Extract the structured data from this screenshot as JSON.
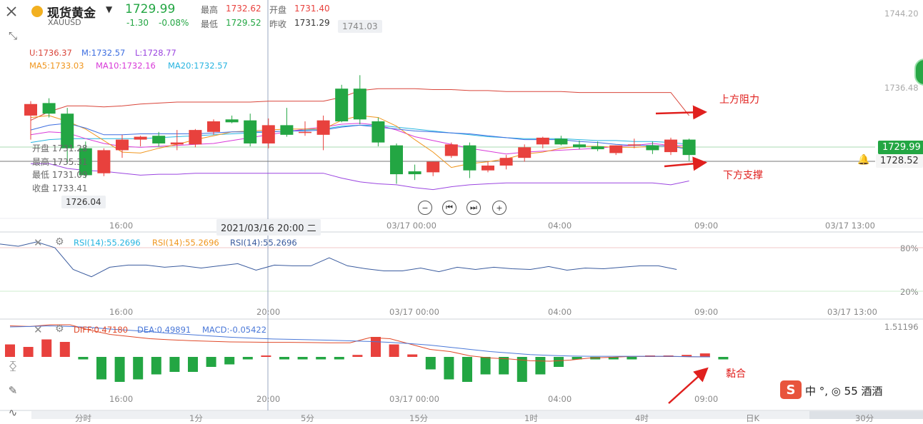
{
  "header": {
    "symbol_name": "现货黄金",
    "symbol_code": "XAUUSD",
    "price": "1729.99",
    "change": "-1.30",
    "change_pct": "-0.08%",
    "high_label": "最高",
    "high": "1732.62",
    "low_label": "最低",
    "low": "1729.52",
    "open_label": "开盘",
    "open": "1731.40",
    "prev_label": "昨收",
    "prev_close": "1731.29"
  },
  "indicators": {
    "boll_u": "U:1736.37",
    "boll_m": "M:1732.57",
    "boll_l": "L:1728.77",
    "ma5": "MA5:1733.03",
    "ma10": "MA10:1732.16",
    "ma20": "MA20:1732.57"
  },
  "crosshair": {
    "open_label": "开盘",
    "open": "1731.28",
    "high_label": "最高",
    "high": "1735.31",
    "low_label": "最低",
    "low": "1731.09",
    "close_label": "收盘",
    "close": "1733.41",
    "price_tag": "1726.04",
    "time_tag": "2021/03/16 20:00 二"
  },
  "price_axis": {
    "top": "1744.20",
    "mid": "1736.48",
    "current": "1729.99",
    "line": "1728.52"
  },
  "high_tag": "1741.03",
  "time_labels": [
    "16:00",
    "20:00",
    "03/17 00:00",
    "04:00",
    "09:00",
    "03/17 13:00"
  ],
  "rsi": {
    "label1": "RSI(14):55.2696",
    "label2": "RSI(14):55.2696",
    "label3": "RSI(14):55.2696",
    "axis_hi": "80%",
    "axis_lo": "20%"
  },
  "macd": {
    "diff": "DIFF:0.47180",
    "dea": "DEA:0.49891",
    "macd": "MACD:-0.05422",
    "axis": "1.51196"
  },
  "annotations": {
    "resistance": "上方阻力",
    "support": "下方支撑",
    "converge": "黏合"
  },
  "bottom_tabs": [
    "分时",
    "1分",
    "5分",
    "15分",
    "1时",
    "4时",
    "日K",
    "30分"
  ],
  "watermark_text": "中 °, ◎ 55 酒酒",
  "colors": {
    "up": "#e8413d",
    "down": "#23a643",
    "boll_u": "#d9453a",
    "boll_m": "#3d6ee0",
    "boll_l": "#9b45e0",
    "ma5": "#f0961e",
    "ma10": "#d83ad8",
    "ma20": "#27b4e0",
    "rsi": "#3a5b9e",
    "diff": "#e04a2a",
    "dea": "#4a78d8"
  },
  "chart_data": {
    "type": "candlestick",
    "candles": [
      {
        "o": 1734.0,
        "h": 1735.5,
        "l": 1731.5,
        "c": 1735.2
      },
      {
        "o": 1735.3,
        "h": 1735.8,
        "l": 1733.8,
        "c": 1734.2
      },
      {
        "o": 1734.2,
        "h": 1734.8,
        "l": 1729.0,
        "c": 1730.6
      },
      {
        "o": 1730.6,
        "h": 1731.3,
        "l": 1727.5,
        "c": 1727.8
      },
      {
        "o": 1728.0,
        "h": 1730.6,
        "l": 1727.7,
        "c": 1730.4
      },
      {
        "o": 1730.4,
        "h": 1732.0,
        "l": 1729.6,
        "c": 1731.5
      },
      {
        "o": 1731.5,
        "h": 1731.9,
        "l": 1730.8,
        "c": 1731.8
      },
      {
        "o": 1731.9,
        "h": 1732.3,
        "l": 1730.8,
        "c": 1731.1
      },
      {
        "o": 1731.0,
        "h": 1732.5,
        "l": 1730.4,
        "c": 1731.2
      },
      {
        "o": 1731.0,
        "h": 1732.6,
        "l": 1730.7,
        "c": 1732.5
      },
      {
        "o": 1732.3,
        "h": 1733.6,
        "l": 1732.0,
        "c": 1733.4
      },
      {
        "o": 1733.6,
        "h": 1734.0,
        "l": 1733.2,
        "c": 1733.3
      },
      {
        "o": 1733.5,
        "h": 1734.2,
        "l": 1730.8,
        "c": 1731.1
      },
      {
        "o": 1731.1,
        "h": 1733.7,
        "l": 1730.6,
        "c": 1733.0
      },
      {
        "o": 1733.0,
        "h": 1734.8,
        "l": 1731.8,
        "c": 1732.0
      },
      {
        "o": 1732.3,
        "h": 1733.4,
        "l": 1731.9,
        "c": 1732.3
      },
      {
        "o": 1732.0,
        "h": 1734.0,
        "l": 1730.4,
        "c": 1733.5
      },
      {
        "o": 1736.8,
        "h": 1737.2,
        "l": 1733.3,
        "c": 1733.4
      },
      {
        "o": 1736.8,
        "h": 1738.2,
        "l": 1733.1,
        "c": 1733.6
      },
      {
        "o": 1733.4,
        "h": 1733.8,
        "l": 1730.8,
        "c": 1731.2
      },
      {
        "o": 1730.9,
        "h": 1731.1,
        "l": 1726.9,
        "c": 1727.9
      },
      {
        "o": 1728.2,
        "h": 1728.9,
        "l": 1727.3,
        "c": 1727.9
      },
      {
        "o": 1728.1,
        "h": 1729.2,
        "l": 1727.7,
        "c": 1729.2
      },
      {
        "o": 1729.8,
        "h": 1731.2,
        "l": 1729.6,
        "c": 1731.0
      },
      {
        "o": 1730.9,
        "h": 1731.2,
        "l": 1727.5,
        "c": 1728.3
      },
      {
        "o": 1728.3,
        "h": 1729.2,
        "l": 1728.1,
        "c": 1728.8
      },
      {
        "o": 1728.8,
        "h": 1729.9,
        "l": 1728.4,
        "c": 1729.6
      },
      {
        "o": 1729.6,
        "h": 1731.0,
        "l": 1729.2,
        "c": 1730.7
      },
      {
        "o": 1731.0,
        "h": 1731.8,
        "l": 1730.6,
        "c": 1731.7
      },
      {
        "o": 1731.6,
        "h": 1731.9,
        "l": 1730.9,
        "c": 1731.0
      },
      {
        "o": 1731.0,
        "h": 1731.4,
        "l": 1730.5,
        "c": 1730.7
      },
      {
        "o": 1730.8,
        "h": 1731.3,
        "l": 1730.3,
        "c": 1730.5
      },
      {
        "o": 1730.1,
        "h": 1730.9,
        "l": 1729.9,
        "c": 1730.9
      },
      {
        "o": 1731.0,
        "h": 1731.6,
        "l": 1730.6,
        "c": 1731.0
      },
      {
        "o": 1730.9,
        "h": 1731.3,
        "l": 1730.0,
        "c": 1730.4
      },
      {
        "o": 1730.2,
        "h": 1731.7,
        "l": 1729.9,
        "c": 1731.5
      },
      {
        "o": 1731.5,
        "h": 1731.6,
        "l": 1729.3,
        "c": 1729.9
      }
    ],
    "bands": {
      "upper": [
        1733.5,
        1734.4,
        1735.0,
        1735.0,
        1734.9,
        1735.0,
        1735.2,
        1735.3,
        1735.4,
        1735.4,
        1735.4,
        1735.4,
        1735.4,
        1735.5,
        1735.5,
        1735.5,
        1735.5,
        1735.9,
        1736.6,
        1736.8,
        1736.8,
        1736.8,
        1736.7,
        1736.7,
        1736.6,
        1736.6,
        1736.5,
        1736.5,
        1736.5,
        1736.5,
        1736.4,
        1736.4,
        1736.4,
        1736.4,
        1736.4,
        1736.4,
        1734.0
      ],
      "middle": [
        1732.5,
        1733.0,
        1733.2,
        1732.7,
        1732.0,
        1732.0,
        1732.1,
        1732.1,
        1732.1,
        1732.1,
        1732.2,
        1732.3,
        1732.3,
        1732.3,
        1732.4,
        1732.4,
        1732.5,
        1732.8,
        1733.0,
        1732.8,
        1732.6,
        1732.4,
        1732.3,
        1732.2,
        1732.1,
        1731.9,
        1731.7,
        1731.5,
        1731.5,
        1731.5,
        1731.3,
        1731.2,
        1731.0,
        1730.9,
        1730.9,
        1730.8,
        1730.5
      ],
      "lower": [
        1729.0,
        1729.0,
        1728.5,
        1728.3,
        1728.2,
        1728.0,
        1727.8,
        1727.9,
        1727.9,
        1728.0,
        1728.0,
        1728.0,
        1728.0,
        1728.0,
        1728.0,
        1728.0,
        1728.0,
        1727.5,
        1727.1,
        1726.9,
        1726.8,
        1726.5,
        1726.3,
        1726.6,
        1726.8,
        1726.9,
        1727.0,
        1727.0,
        1727.0,
        1727.0,
        1727.0,
        1727.0,
        1727.0,
        1727.0,
        1727.0,
        1726.8,
        1727.2
      ],
      "ma5": [
        1733.8,
        1734.0,
        1733.4,
        1732.6,
        1731.4,
        1730.2,
        1730.1,
        1730.6,
        1731.0,
        1731.5,
        1731.9,
        1732.3,
        1732.4,
        1732.5,
        1732.6,
        1732.6,
        1732.6,
        1733.5,
        1734.0,
        1733.8,
        1732.9,
        1731.5,
        1730.2,
        1728.6,
        1729.0,
        1729.2,
        1729.5,
        1730.0,
        1730.2,
        1730.6,
        1730.8,
        1730.8,
        1730.7,
        1730.7,
        1730.8,
        1730.9,
        1730.6
      ],
      "ma10": [
        1732.0,
        1732.3,
        1732.2,
        1731.6,
        1731.1,
        1730.8,
        1730.7,
        1730.8,
        1730.9,
        1731.0,
        1731.1,
        1731.4,
        1731.7,
        1732.0,
        1732.3,
        1732.6,
        1732.8,
        1733.1,
        1733.2,
        1733.0,
        1732.5,
        1731.8,
        1731.4,
        1731.0,
        1730.6,
        1730.3,
        1730.0,
        1730.2,
        1730.3,
        1730.4,
        1730.5,
        1730.6,
        1730.8,
        1730.9,
        1731.1,
        1730.9,
        1730.9
      ],
      "ma20": [
        1731.2,
        1731.5,
        1731.6,
        1731.6,
        1731.6,
        1731.6,
        1731.6,
        1731.7,
        1731.8,
        1731.9,
        1732.0,
        1732.1,
        1732.2,
        1732.3,
        1732.4,
        1732.5,
        1732.6,
        1732.9,
        1733.0,
        1733.0,
        1732.8,
        1732.6,
        1732.4,
        1732.2,
        1732.0,
        1731.8,
        1731.7,
        1731.6,
        1731.6,
        1731.6,
        1731.5,
        1731.4,
        1731.4,
        1731.3,
        1731.3,
        1731.2,
        1731.0
      ]
    },
    "rsi": [
      85,
      82,
      88,
      80,
      50,
      40,
      53,
      56,
      56,
      53,
      55,
      52,
      55,
      58,
      49,
      56,
      55,
      55,
      66,
      55,
      51,
      48,
      48,
      52,
      47,
      53,
      50,
      53,
      51,
      50,
      54,
      49,
      52,
      51,
      53,
      55,
      55,
      50
    ],
    "macd_hist": [
      0.25,
      0.2,
      0.35,
      0.3,
      -0.05,
      -0.45,
      -0.5,
      -0.45,
      -0.35,
      -0.3,
      -0.3,
      -0.2,
      -0.15,
      -0.05,
      0.0,
      -0.05,
      -0.05,
      -0.05,
      -0.05,
      0.04,
      0.4,
      0.25,
      0.05,
      -0.25,
      -0.45,
      -0.5,
      -0.35,
      -0.35,
      -0.5,
      -0.35,
      -0.2,
      -0.05,
      -0.05,
      -0.05,
      -0.05,
      0.0,
      0.0,
      0.04,
      0.07,
      -0.05
    ],
    "macd_diff": [
      1.45,
      1.42,
      1.5,
      1.5,
      1.25,
      1.05,
      0.95,
      0.85,
      0.8,
      0.76,
      0.73,
      0.7,
      0.69,
      0.68,
      0.68,
      0.67,
      0.66,
      0.66,
      0.9,
      0.85,
      0.6,
      0.35,
      0.25,
      0.05,
      -0.05,
      -0.1,
      -0.18,
      -0.2,
      -0.15,
      -0.05,
      -0.02,
      0.02,
      0.02,
      0.02,
      0.01,
      0.0
    ],
    "macd_dea": [
      1.4,
      1.42,
      1.45,
      1.42,
      1.38,
      1.3,
      1.24,
      1.18,
      1.1,
      1.04,
      0.98,
      0.92,
      0.88,
      0.84,
      0.82,
      0.8,
      0.78,
      0.75,
      0.72,
      0.68,
      0.62,
      0.55,
      0.45,
      0.35,
      0.25,
      0.18,
      0.11,
      0.07,
      0.04,
      0.03,
      0.03,
      0.03,
      0.03,
      0.03,
      0.01,
      0.0
    ]
  }
}
